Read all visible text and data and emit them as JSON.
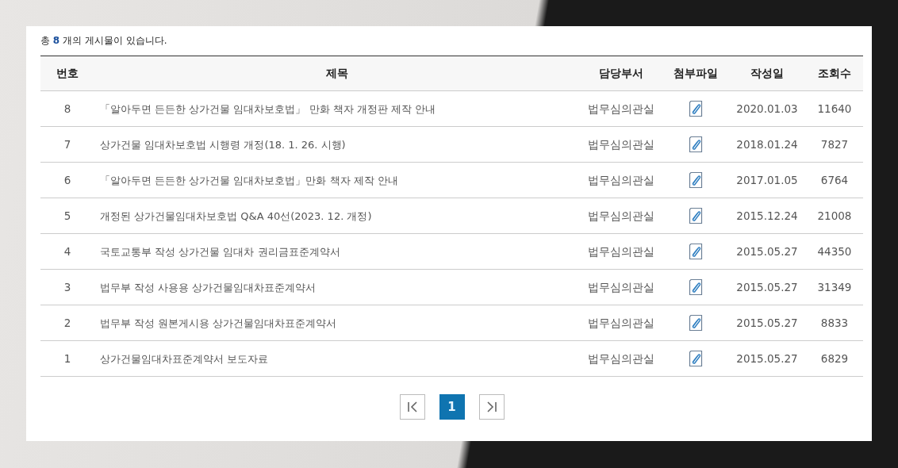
{
  "summary": "총 **8** 개의 게시물이 있습니다.",
  "table": {
    "columns": [
      "번호",
      "제목",
      "담당부서",
      "첨부파일",
      "작성일",
      "조회수"
    ],
    "rows": [
      {
        "number": "8",
        "title": "「알아두면 든든한 상가건물 임대차보호법」 만화 책자 개정판 제작 안내",
        "department": "법무심의관실",
        "attachment": true,
        "date": "2020.01.03",
        "views": "11640"
      },
      {
        "number": "7",
        "title": "상가건물 임대차보호법 시행령 개정(18. 1. 26. 시행)",
        "department": "법무심의관실",
        "attachment": true,
        "date": "2018.01.24",
        "views": "7827"
      },
      {
        "number": "6",
        "title": "「알아두면 든든한 상가건물 임대차보호법」만화 책자 제작 안내",
        "department": "법무심의관실",
        "attachment": true,
        "date": "2017.01.05",
        "views": "6764"
      },
      {
        "number": "5",
        "title": "개정된 상가건물임대차보호법 Q&A 40선(2023. 12. 개정)",
        "department": "법무심의관실",
        "attachment": true,
        "date": "2015.12.24",
        "views": "21008"
      },
      {
        "number": "4",
        "title": "국토교통부 작성 상가건물 임대차 권리금표준계약서",
        "department": "법무심의관실",
        "attachment": true,
        "date": "2015.05.27",
        "views": "44350"
      },
      {
        "number": "3",
        "title": "법무부 작성 사용용 상가건물임대차표준계약서",
        "department": "법무심의관실",
        "attachment": true,
        "date": "2015.05.27",
        "views": "31349"
      },
      {
        "number": "2",
        "title": "법무부 작성 원본게시용 상가건물임대차표준계약서",
        "department": "법무심의관실",
        "attachment": true,
        "date": "2015.05.27",
        "views": "8833"
      },
      {
        "number": "1",
        "title": "상가건물임대차표준계약서 보도자료",
        "department": "법무심의관실",
        "attachment": true,
        "date": "2015.05.27",
        "views": "6829"
      }
    ]
  },
  "pagination": {
    "pages": [
      {
        "label": "1",
        "selected": true
      }
    ]
  }
}
